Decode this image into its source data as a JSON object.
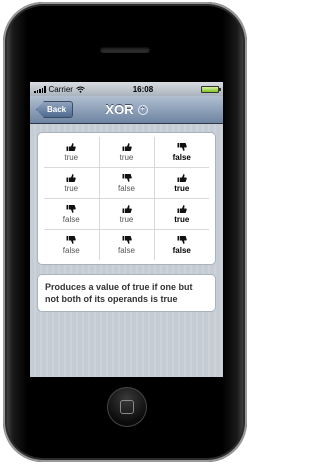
{
  "status": {
    "carrier": "Carrier",
    "time": "16:08"
  },
  "nav": {
    "back_label": "Back",
    "title": "XOR",
    "info_icon": "info-circle-icon"
  },
  "table": {
    "rows": [
      {
        "a": "true",
        "b": "true",
        "result": "false",
        "a_icon": "thumbs-up-icon",
        "b_icon": "thumbs-up-icon",
        "result_icon": "thumbs-down-icon"
      },
      {
        "a": "true",
        "b": "false",
        "result": "true",
        "a_icon": "thumbs-up-icon",
        "b_icon": "thumbs-down-icon",
        "result_icon": "thumbs-up-icon"
      },
      {
        "a": "false",
        "b": "true",
        "result": "true",
        "a_icon": "thumbs-down-icon",
        "b_icon": "thumbs-up-icon",
        "result_icon": "thumbs-up-icon"
      },
      {
        "a": "false",
        "b": "false",
        "result": "false",
        "a_icon": "thumbs-down-icon",
        "b_icon": "thumbs-down-icon",
        "result_icon": "thumbs-down-icon"
      }
    ]
  },
  "description": "Produces a value of true if one but not both of its operands is true",
  "colors": {
    "nav_top": "#b1bfd0",
    "nav_bottom": "#6d84a2",
    "background": "#c7ccd5"
  }
}
